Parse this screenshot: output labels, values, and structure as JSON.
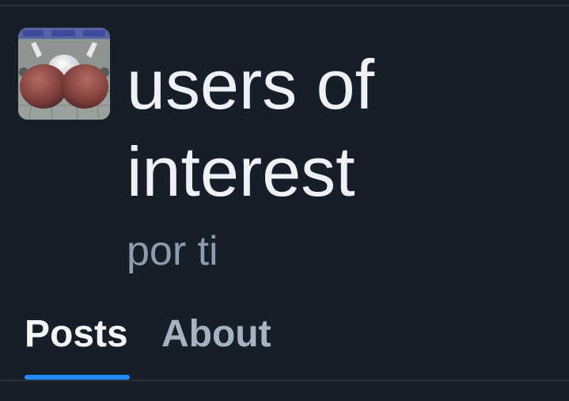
{
  "feed": {
    "title": "users of interest",
    "author": "por ti",
    "avatar_icon": "feed-avatar-image"
  },
  "tabs": [
    {
      "label": "Posts",
      "active": true
    },
    {
      "label": "About",
      "active": false
    }
  ],
  "colors": {
    "background": "#161e27",
    "title_text": "#eef2f6",
    "secondary_text": "#8d9cb0",
    "inactive_tab": "#a4b2c2",
    "accent": "#208bfe",
    "divider": "#26303d"
  }
}
